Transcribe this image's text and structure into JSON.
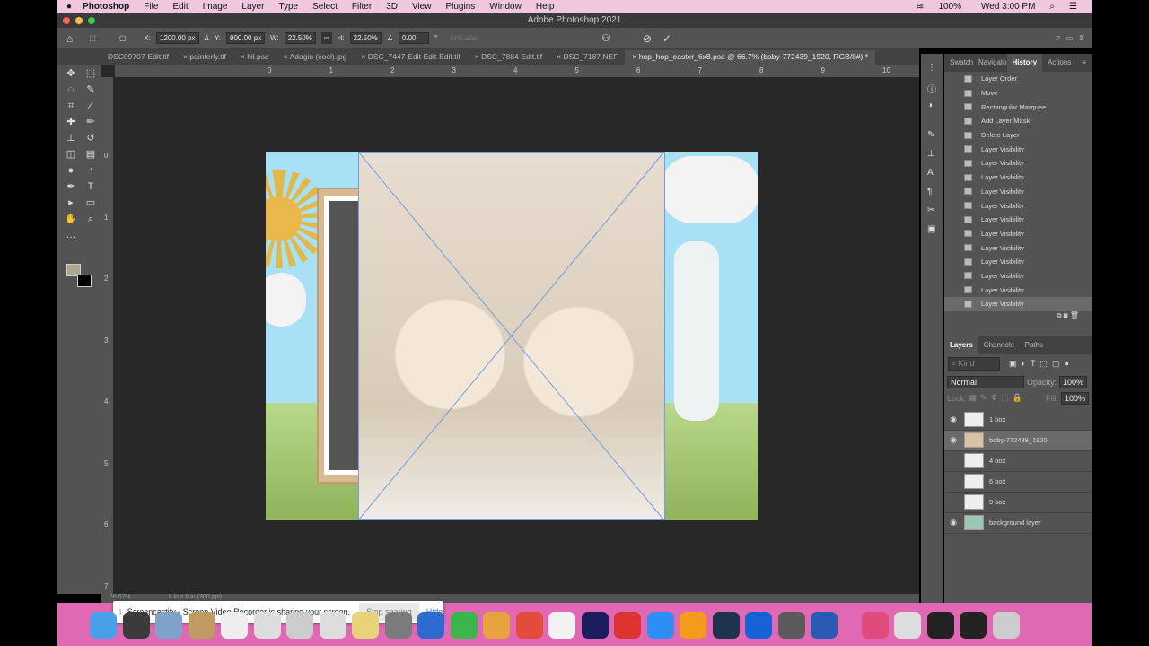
{
  "menubar": {
    "app": "Photoshop",
    "items": [
      "File",
      "Edit",
      "Image",
      "Layer",
      "Type",
      "Select",
      "Filter",
      "3D",
      "View",
      "Plugins",
      "Window",
      "Help"
    ],
    "battery": "100%",
    "clock": "Wed 3:00 PM"
  },
  "window": {
    "title": "Adobe Photoshop 2021"
  },
  "options": {
    "x_label": "X:",
    "x": "1200.00 px",
    "y_label": "Y:",
    "y": "900.00 px",
    "w_label": "W:",
    "w": "22.50%",
    "h_label": "H:",
    "h": "22.50%",
    "angle": "0.00",
    "angle_unit": "°",
    "antialias": "Anti-alias"
  },
  "tabs": [
    "DSC09707-Edit.tif",
    "painterly.tif",
    "hil.psd",
    "Adagio (cool).jpg",
    "DSC_7447-Edit-Edit-Edit.tif",
    "DSC_7884-Edit.tif",
    "DSC_7187.NEF",
    "hop_hop_easter_6x8.psd @ 66.7% (baby-772439_1920, RGB/8#) *"
  ],
  "ruler_h": [
    "0",
    "1",
    "2",
    "3",
    "4",
    "5",
    "6",
    "7",
    "8",
    "9",
    "10"
  ],
  "ruler_v": [
    "0",
    "1",
    "2",
    "3",
    "4",
    "5",
    "6",
    "7"
  ],
  "status": {
    "zoom": "66.67%",
    "doc": "8 in x 6 in (300 ppi)"
  },
  "history": {
    "tabs": [
      "Swatches",
      "Navigator",
      "History",
      "Actions"
    ],
    "items": [
      "Layer Order",
      "Move",
      "Rectangular Marquee",
      "Add Layer Mask",
      "Delete Layer",
      "Layer Visibility",
      "Layer Visibility",
      "Layer Visibility",
      "Layer Visibility",
      "Layer Visibility",
      "Layer Visibility",
      "Layer Visibility",
      "Layer Visibility",
      "Layer Visibility",
      "Layer Visibility",
      "Layer Visibility",
      "Layer Visibility"
    ]
  },
  "layers": {
    "tabs": [
      "Layers",
      "Channels",
      "Paths"
    ],
    "kind": "Kind",
    "blend": "Normal",
    "opacity_label": "Opacity:",
    "opacity": "100%",
    "lock_label": "Lock:",
    "fill_label": "Fill:",
    "fill": "100%",
    "items": [
      {
        "name": "1 box",
        "visible": true
      },
      {
        "name": "baby-772439_1920",
        "visible": true
      },
      {
        "name": "4 box",
        "visible": false
      },
      {
        "name": "6 box",
        "visible": false
      },
      {
        "name": "9 box",
        "visible": false
      },
      {
        "name": "background layer",
        "visible": true
      }
    ]
  },
  "share": {
    "message": "Screencastify - Screen Video Recorder is sharing your screen.",
    "stop": "Stop sharing",
    "hide": "Hide"
  }
}
